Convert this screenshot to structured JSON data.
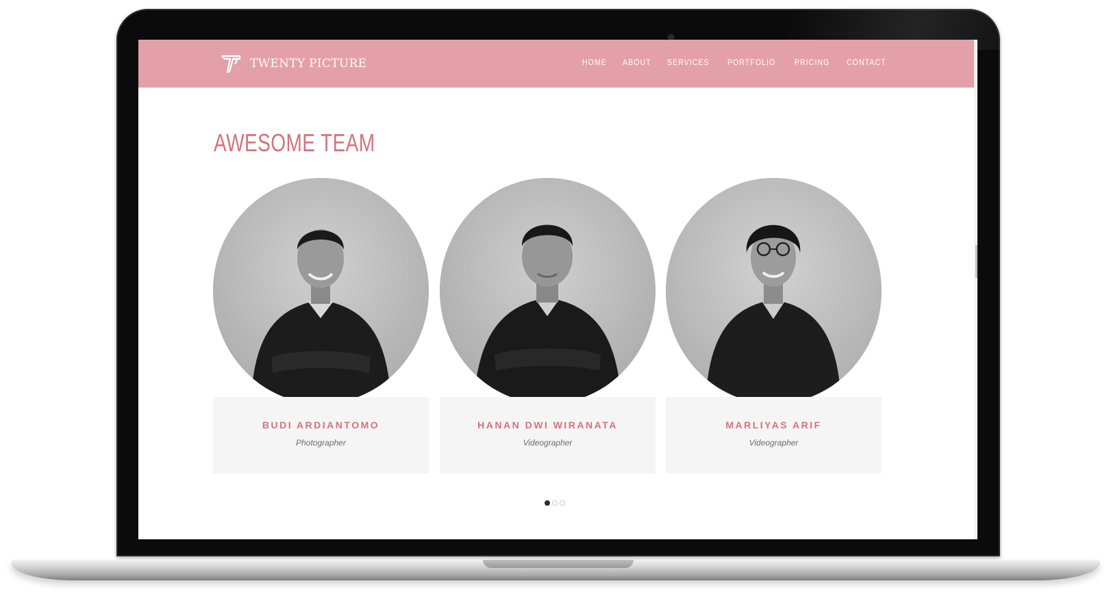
{
  "brand": {
    "name": "TWENTY PICTURE",
    "accent": "#e4a0a8",
    "title_color": "#d4727d"
  },
  "nav": {
    "items": [
      "HOME",
      "ABOUT",
      "SERVICES",
      "PORTFOLIO",
      "PRICING",
      "CONTACT"
    ]
  },
  "team": {
    "title": "AWESOME TEAM",
    "members": [
      {
        "name": "BUDI ARDIANTOMO",
        "role": "Photographer"
      },
      {
        "name": "HANAN DWI WIRANATA",
        "role": "Videographer"
      },
      {
        "name": "MARLIYAS ARIF",
        "role": "Videographer"
      }
    ],
    "slider": {
      "pages": 3,
      "active_page": 1
    }
  }
}
